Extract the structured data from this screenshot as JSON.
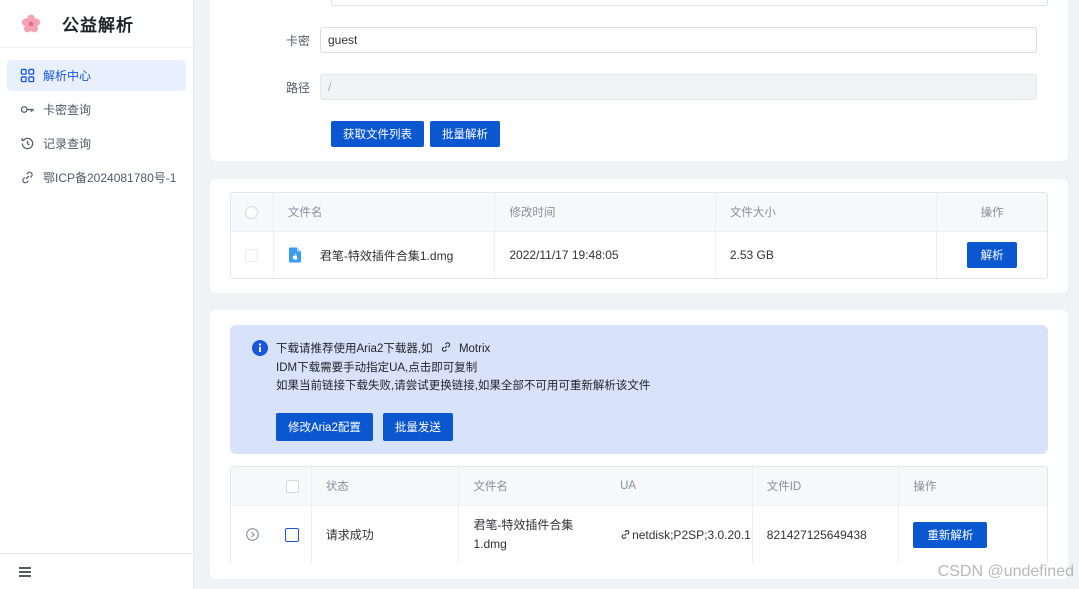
{
  "app": {
    "title": "公益解析"
  },
  "sidebar": {
    "items": [
      {
        "label": "解析中心",
        "icon": "grid-icon",
        "active": true
      },
      {
        "label": "卡密查询",
        "icon": "key-icon",
        "active": false
      },
      {
        "label": "记录查询",
        "icon": "history-icon",
        "active": false
      },
      {
        "label": "鄂ICP备2024081780号-1",
        "icon": "link-icon",
        "active": false
      }
    ],
    "footer_icon": "menu-icon"
  },
  "form": {
    "card_key_label": "卡密",
    "card_key_value": "guest",
    "path_label": "路径",
    "path_value": "/",
    "get_list_button": "获取文件列表",
    "batch_parse_button": "批量解析"
  },
  "file_table": {
    "headers": [
      "文件名",
      "修改时间",
      "文件大小",
      "操作"
    ],
    "rows": [
      {
        "name": "君笔-特效插件合集1.dmg",
        "modified": "2022/11/17 19:48:05",
        "size": "2.53 GB",
        "action": "解析",
        "icon": "apple-file-icon"
      }
    ]
  },
  "notice": {
    "line1_prefix": "下载请推荐使用Aria2下载器,如",
    "line1_link": "Motrix",
    "line2": "IDM下载需要手动指定UA,点击即可复制",
    "line3": "如果当前链接下载失败,请尝试更换链接,如果全部不可用可重新解析该文件",
    "aria2_button": "修改Aria2配置",
    "batch_send_button": "批量发送"
  },
  "result_table": {
    "headers": [
      "状态",
      "文件名",
      "UA",
      "文件ID",
      "操作"
    ],
    "rows": [
      {
        "status": "请求成功",
        "name_line1": "君笔-特效插件合集",
        "name_line2": "1.dmg",
        "ua": "netdisk;P2SP;3.0.20.1",
        "file_id": "821427125649438",
        "action": "重新解析"
      }
    ]
  },
  "watermark": "CSDN @undefined",
  "colors": {
    "primary": "#0b57d0",
    "active_bg": "#e8f0fe",
    "notice_bg": "#d9e2fb"
  }
}
